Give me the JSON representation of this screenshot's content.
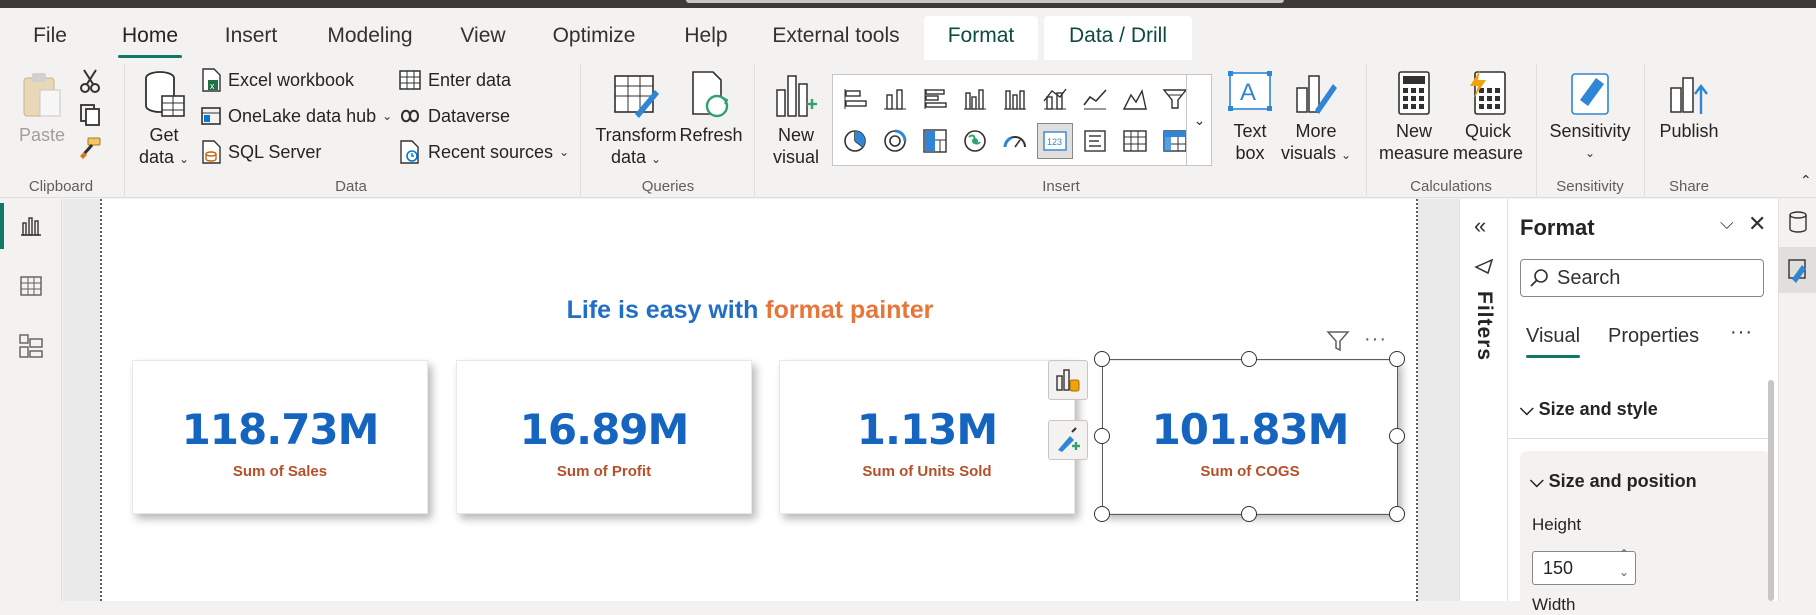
{
  "menu": {
    "tabs": [
      "File",
      "Home",
      "Insert",
      "Modeling",
      "View",
      "Optimize",
      "Help",
      "External tools",
      "Format",
      "Data / Drill"
    ]
  },
  "ribbon": {
    "clipboard": {
      "paste": "Paste",
      "label": "Clipboard"
    },
    "data": {
      "get_data": [
        "Get",
        "data"
      ],
      "excel": "Excel workbook",
      "onelake": "OneLake data hub",
      "sql": "SQL Server",
      "enter": "Enter data",
      "dataverse": "Dataverse",
      "recent": "Recent sources",
      "label": "Data"
    },
    "queries": {
      "transform": [
        "Transform",
        "data"
      ],
      "refresh": "Refresh",
      "label": "Queries"
    },
    "insert": {
      "new_visual": [
        "New",
        "visual"
      ],
      "text_box": [
        "Text",
        "box"
      ],
      "more_visuals": [
        "More",
        "visuals"
      ],
      "label": "Insert"
    },
    "calculations": {
      "new_measure": [
        "New",
        "measure"
      ],
      "quick_measure": [
        "Quick",
        "measure"
      ],
      "label": "Calculations"
    },
    "sensitivity": {
      "btn": "Sensitivity",
      "label": "Sensitivity"
    },
    "share": {
      "publish": "Publish",
      "label": "Share"
    }
  },
  "report": {
    "headline_part1": "Life is easy with ",
    "headline_part2": "format painter",
    "cards": [
      {
        "value": "118.73M",
        "label": "Sum of  Sales"
      },
      {
        "value": "16.89M",
        "label": "Sum of Profit"
      },
      {
        "value": "1.13M",
        "label": "Sum of Units Sold"
      },
      {
        "value": "101.83M",
        "label": "Sum of COGS"
      }
    ]
  },
  "filters": {
    "label": "Filters"
  },
  "format_pane": {
    "title": "Format",
    "search_placeholder": "Search",
    "tabs": [
      "Visual",
      "Properties"
    ],
    "section_size_style": "Size and style",
    "section_size_position": "Size and position",
    "height_label": "Height",
    "height_value": "150",
    "width_label": "Width"
  },
  "colors": {
    "accent": "#117865",
    "card_value": "#1565c0",
    "card_label": "#b5502a",
    "headline_blue": "#1f6fc6",
    "headline_orange": "#e8753a"
  }
}
